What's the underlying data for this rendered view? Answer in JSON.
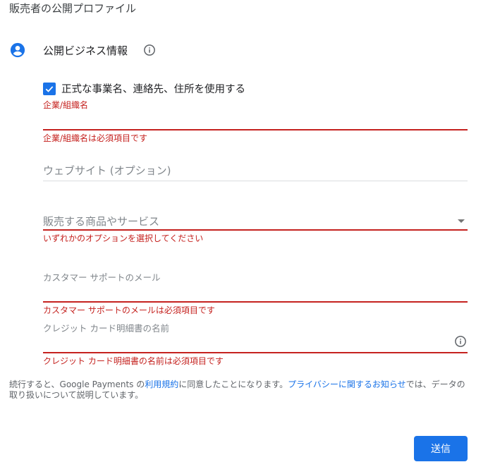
{
  "page": {
    "title": "販売者の公開プロファイル"
  },
  "section": {
    "title": "公開ビジネス情報",
    "icon": "account-circle-icon",
    "info_icon": "info-icon",
    "accent_color": "#1a73e8"
  },
  "checkbox": {
    "label": "正式な事業名、連絡先、住所を使用する",
    "checked": true
  },
  "fields": {
    "company_name": {
      "label": "企業/組織名",
      "value": "",
      "error": "企業/組織名は必須項目です"
    },
    "website": {
      "placeholder": "ウェブサイト (オプション)",
      "value": ""
    },
    "products": {
      "placeholder": "販売する商品やサービス",
      "error": "いずれかのオプションを選択してください"
    },
    "support_email": {
      "label": "カスタマー サポートのメール",
      "value": "",
      "error": "カスタマー サポートのメールは必須項目です"
    },
    "statement_name": {
      "label": "クレジット カード明細書の名前",
      "value": "",
      "error": "クレジット カード明細書の名前は必須項目です",
      "info_icon": "info-icon"
    }
  },
  "footer": {
    "text_before": "続行すると、Google Payments の",
    "terms_link": "利用規約",
    "text_middle": "に同意したことになります。",
    "privacy_link": "プライバシーに関するお知らせ",
    "text_after": "では、データの取り扱いについて説明しています。"
  },
  "submit": {
    "label": "送信"
  },
  "colors": {
    "error": "#c5221f",
    "primary": "#1a73e8",
    "divider": "#dadce0"
  }
}
